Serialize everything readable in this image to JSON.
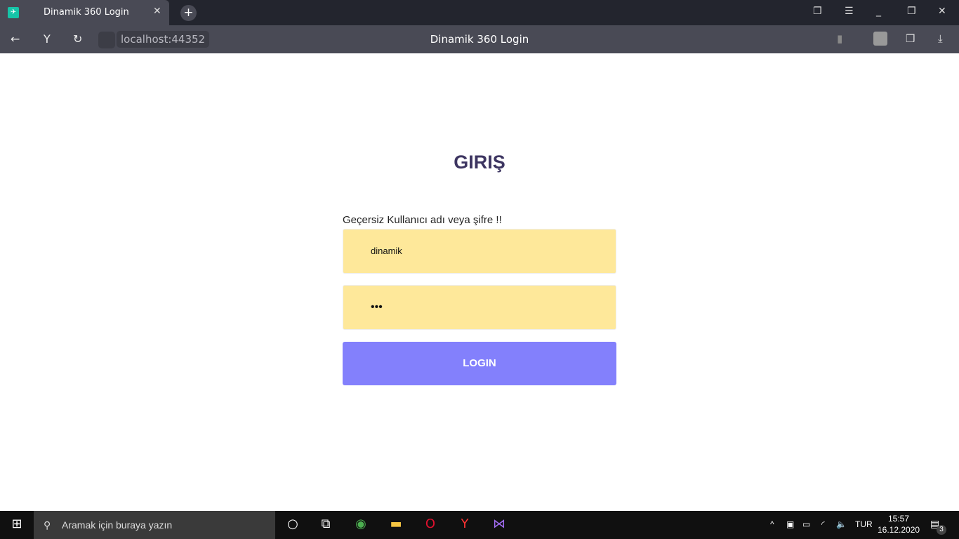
{
  "browser": {
    "tab_title": "Dinamik 360 Login",
    "url": "localhost:44352",
    "page_title": "Dinamik 360 Login"
  },
  "page": {
    "heading": "GIRIŞ",
    "error": "Geçersiz Kullanıcı adı veya şifre !!",
    "username": "dinamik",
    "password": "•••",
    "login_label": "LOGIN"
  },
  "taskbar": {
    "search_placeholder": "Aramak için buraya yazın",
    "language": "TUR",
    "time": "15:57",
    "date": "16.12.2020",
    "notifications": "3"
  },
  "colors": {
    "heading": "#3d3561",
    "input_bg": "#fee89a",
    "button": "#8380fc"
  }
}
